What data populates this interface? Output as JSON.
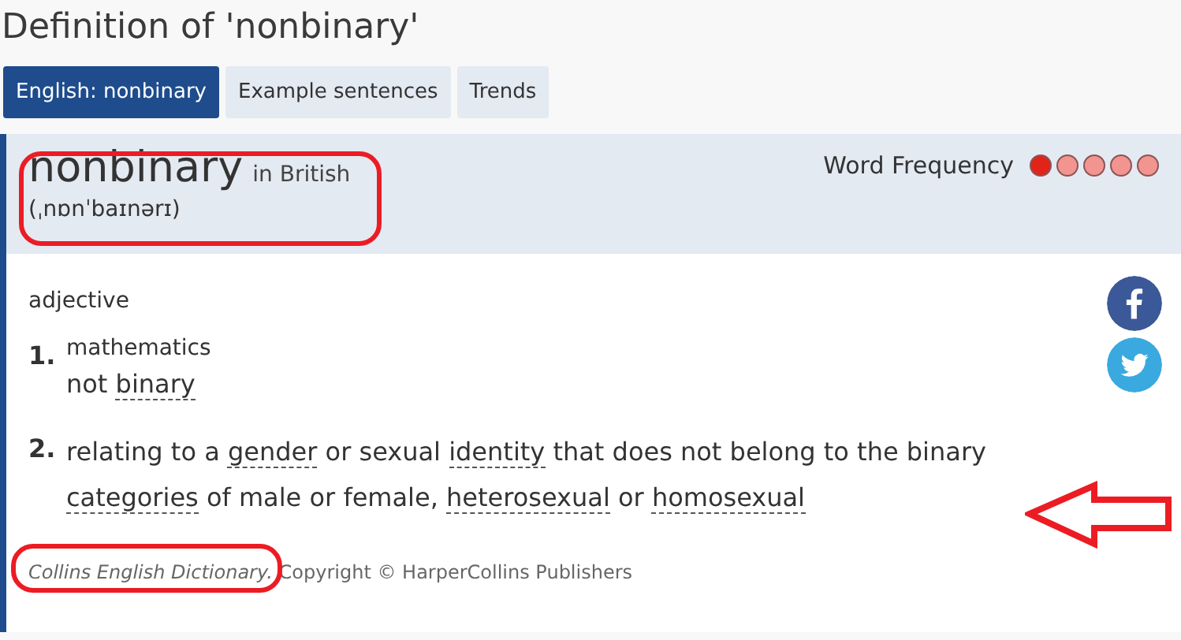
{
  "page_title": "Definition of 'nonbinary'",
  "tabs": [
    {
      "label": "English: nonbinary",
      "selected": true
    },
    {
      "label": "Example sentences",
      "selected": false
    },
    {
      "label": "Trends",
      "selected": false
    }
  ],
  "entry": {
    "headword": "nonbinary",
    "region": "in British",
    "pronunciation": "(ˌnɒnˈbaɪnərɪ)",
    "frequency_label": "Word Frequency",
    "frequency_dots": [
      {
        "on": true
      },
      {
        "on": false
      },
      {
        "on": false
      },
      {
        "on": false
      },
      {
        "on": false
      }
    ],
    "part_of_speech": "adjective",
    "senses": [
      {
        "number": "1.",
        "domain": "mathematics",
        "definition": [
          {
            "text": "not ",
            "link": false
          },
          {
            "text": "binary",
            "link": true
          }
        ]
      },
      {
        "number": "2.",
        "definition": [
          {
            "text": "relating to a ",
            "link": false
          },
          {
            "text": "gender",
            "link": true
          },
          {
            "text": " or sexual ",
            "link": false
          },
          {
            "text": "identity",
            "link": true
          },
          {
            "text": " that does not belong to the binary ",
            "link": false
          },
          {
            "text": "categories",
            "link": true
          },
          {
            "text": " of male or female, ",
            "link": false
          },
          {
            "text": "heterosexual",
            "link": true
          },
          {
            "text": " or ",
            "link": false
          },
          {
            "text": "homosexual",
            "link": true
          }
        ]
      }
    ],
    "source": "*Collins English Dictionary.* Copyright © HarperCollins Publishers"
  }
}
